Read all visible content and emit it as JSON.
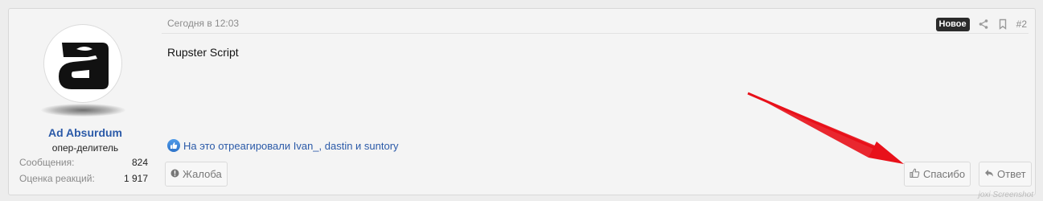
{
  "user": {
    "name": "Ad Absurdum",
    "title": "опер-делитель",
    "avatar_letter": "a",
    "stats": [
      {
        "label": "Сообщения:",
        "value": "824"
      },
      {
        "label": "Оценка реакций:",
        "value": "1 917"
      }
    ]
  },
  "post": {
    "date": "Сегодня в 12:03",
    "badge": "Новое",
    "number": "#2",
    "content": "Rupster Script",
    "reactions_text": "На это отреагировали Ivan_, dastin и suntory"
  },
  "actions": {
    "report": "Жалоба",
    "like": "Спасибо",
    "reply": "Ответ"
  },
  "icons": {
    "share": "share-icon",
    "bookmark": "bookmark-icon",
    "report": "warning-icon",
    "like": "thumbs-up-icon",
    "reply": "reply-icon"
  },
  "watermark": "joxi Screenshot",
  "colors": {
    "link": "#2b5aa8",
    "badge_bg": "#2b2b2b",
    "annotation_arrow": "#e8111a"
  }
}
